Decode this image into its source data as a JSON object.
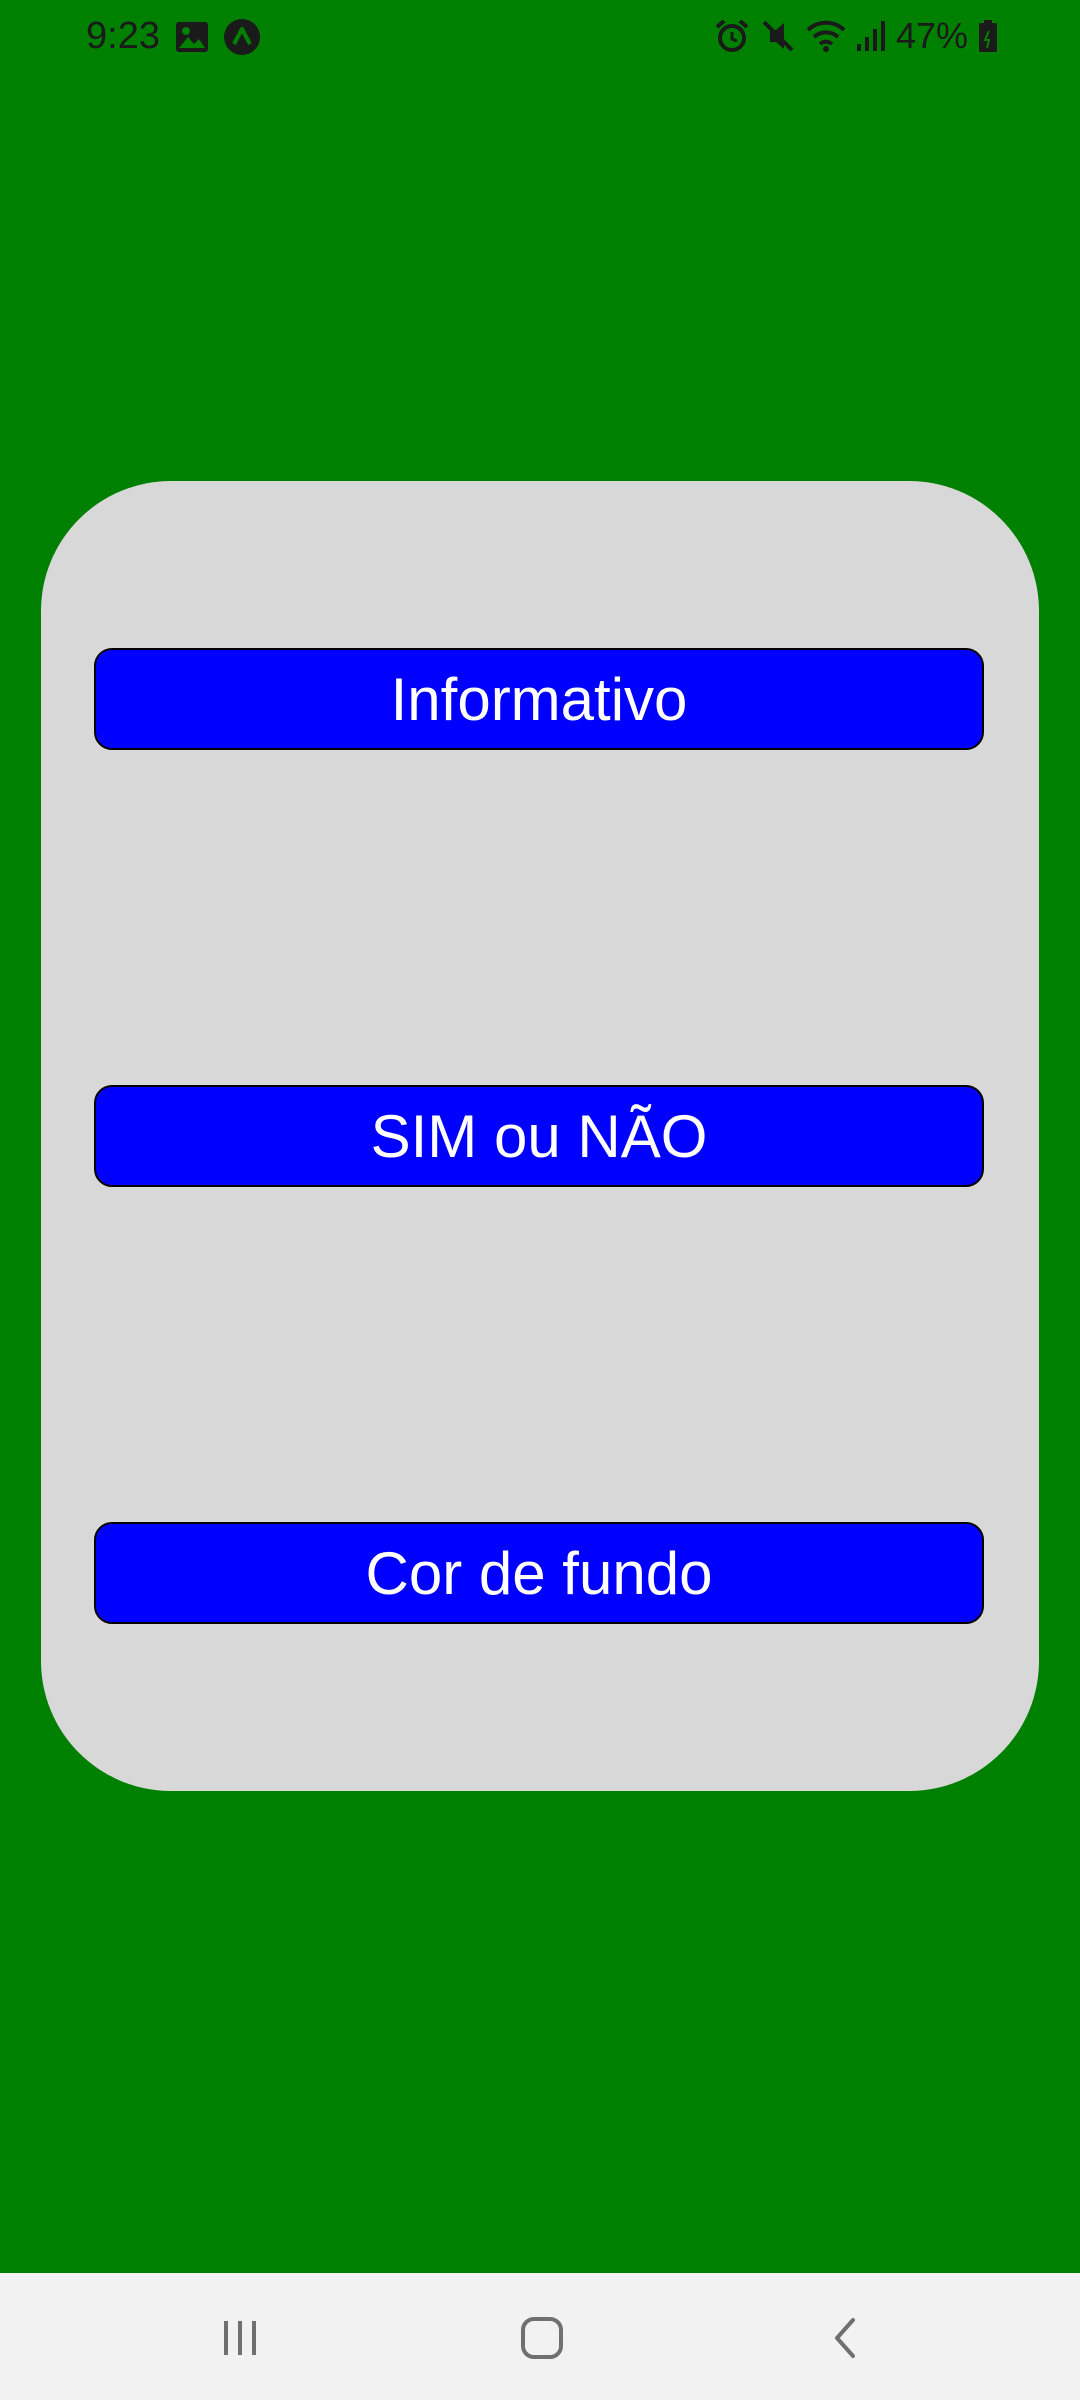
{
  "status_bar": {
    "time": "9:23",
    "battery_percent": "47%",
    "left_icons": [
      "image-icon",
      "app-notification-icon"
    ],
    "right_icons": [
      "alarm-icon",
      "mute-icon",
      "wifi-icon",
      "signal-icon",
      "battery-icon"
    ]
  },
  "colors": {
    "background": "#008000",
    "card": "#d8d8d8",
    "button": "#0000ff",
    "button_text": "#ffffff"
  },
  "buttons": [
    {
      "label": "Informativo"
    },
    {
      "label": "SIM ou NÃO"
    },
    {
      "label": "Cor de fundo"
    }
  ],
  "nav_bar": {
    "items": [
      "recents-icon",
      "home-icon",
      "back-icon"
    ]
  }
}
